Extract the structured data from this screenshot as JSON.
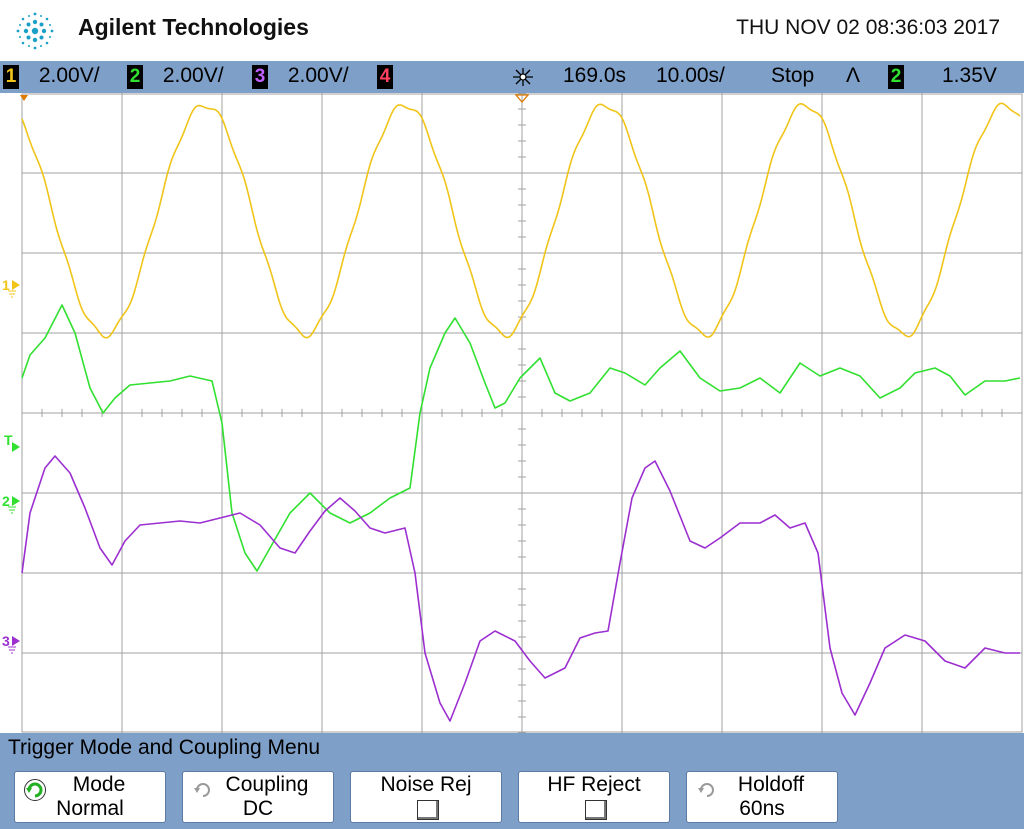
{
  "header": {
    "brand": "Agilent Technologies",
    "datetime": "THU NOV 02 08:36:03 2017"
  },
  "statusbar": {
    "channels": [
      {
        "num": "1",
        "scale": "2.00V/",
        "color": "#f0c419"
      },
      {
        "num": "2",
        "scale": "2.00V/",
        "color": "#31e030"
      },
      {
        "num": "3",
        "scale": "2.00V/",
        "color": "#c060ff"
      },
      {
        "num": "4",
        "scale": "",
        "color": "#ff4060"
      }
    ],
    "delay": "169.0s",
    "timebase": "10.00s/",
    "run_state": "Stop",
    "trigger_slope": "Ʌ",
    "trigger_source": "2",
    "trigger_level": "1.35V"
  },
  "markers": {
    "ch1": "1",
    "trig": "T",
    "ch2": "2",
    "ch3": "3"
  },
  "colors": {
    "ch1": "#f0c419",
    "ch2": "#31e030",
    "ch3": "#9c2fd0",
    "grid": "#a0a0a0",
    "bar": "#7e9fc7"
  },
  "menu": {
    "title": "Trigger Mode and Coupling Menu",
    "softkeys": [
      {
        "label": "Mode",
        "value": "Normal",
        "icon": "rotate-icon-green"
      },
      {
        "label": "Coupling",
        "value": "DC",
        "icon": "rotate-icon-gray"
      },
      {
        "label": "Noise Rej",
        "value": "",
        "icon": "checkbox-icon"
      },
      {
        "label": "HF Reject",
        "value": "",
        "icon": "checkbox-icon"
      },
      {
        "label": "Holdoff",
        "value": "60ns",
        "icon": "rotate-icon-gray"
      }
    ]
  }
}
